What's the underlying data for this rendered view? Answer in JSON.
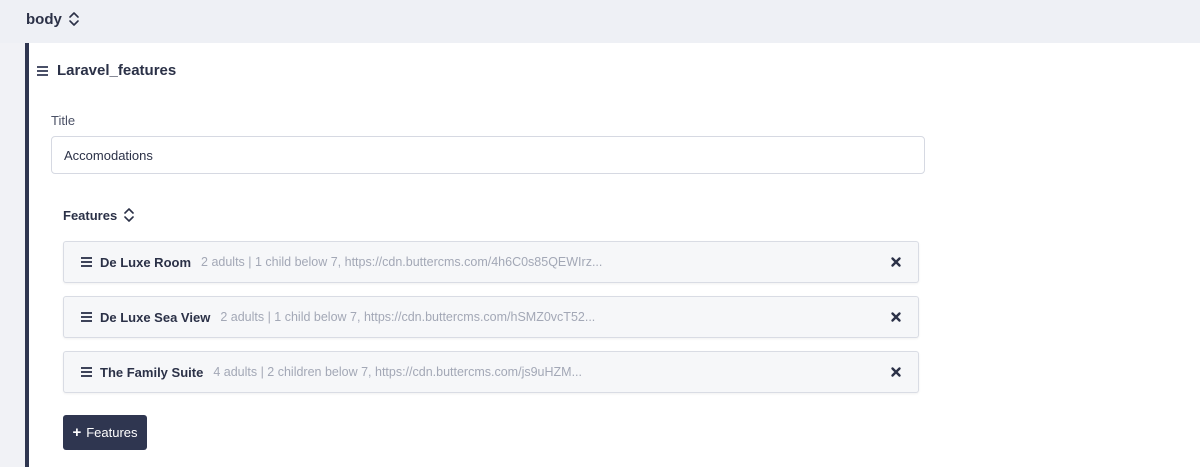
{
  "body_section": {
    "label": "body"
  },
  "component": {
    "name": "Laravel_features",
    "title_field": {
      "label": "Title",
      "value": "Accomodations"
    },
    "features": {
      "label": "Features",
      "items": [
        {
          "name": "De Luxe Room",
          "summary": "2 adults | 1 child below 7, https://cdn.buttercms.com/4h6C0s85QEWIrz..."
        },
        {
          "name": "De Luxe Sea View",
          "summary": "2 adults | 1 child below 7, https://cdn.buttercms.com/hSMZ0vcT52..."
        },
        {
          "name": "The Family Suite",
          "summary": "4 adults | 2 children below 7, https://cdn.buttercms.com/js9uHZM..."
        }
      ],
      "add_button": {
        "icon": "plus-icon",
        "label": "Features"
      }
    }
  },
  "colors": {
    "accent": "#2f3650",
    "page_bg": "#f1f2f6",
    "muted_text": "#a3a8b6"
  }
}
